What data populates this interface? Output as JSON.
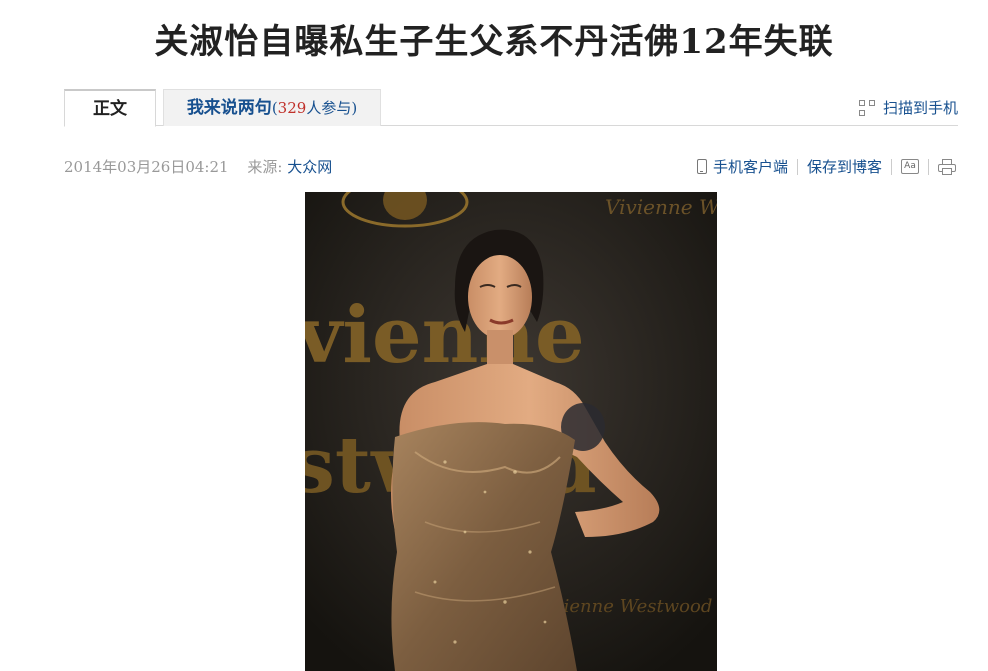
{
  "article": {
    "title": "关淑怡自曝私生子生父系不丹活佛12年失联"
  },
  "tabs": {
    "main_label": "正文",
    "comment_label": "我来说两句",
    "comment_open": "(",
    "comment_count": "329",
    "comment_suffix": "人参与)"
  },
  "scan": {
    "label": "扫描到手机",
    "icon": "qr-code-icon"
  },
  "meta": {
    "datetime": "2014年03月26日04:21",
    "source_label": "来源:",
    "source": "大众网"
  },
  "tools": {
    "mobile_client": "手机客户端",
    "save_to_blog": "保存到博客",
    "font_icon_text": "Aa",
    "icons": [
      "phone-icon",
      "font-size-icon",
      "print-icon"
    ]
  },
  "photo": {
    "backdrop_text_top": "Vivienne Westwood",
    "backdrop_text_big_1": "vienne",
    "backdrop_text_big_2": "stwood",
    "backdrop_text_bottom": "Vivienne Westwood",
    "colors": {
      "backdrop": "#2a2622",
      "gold_text": "#8a6a2a",
      "dress": "#8a6a48",
      "skin": "#d9a27a"
    }
  }
}
